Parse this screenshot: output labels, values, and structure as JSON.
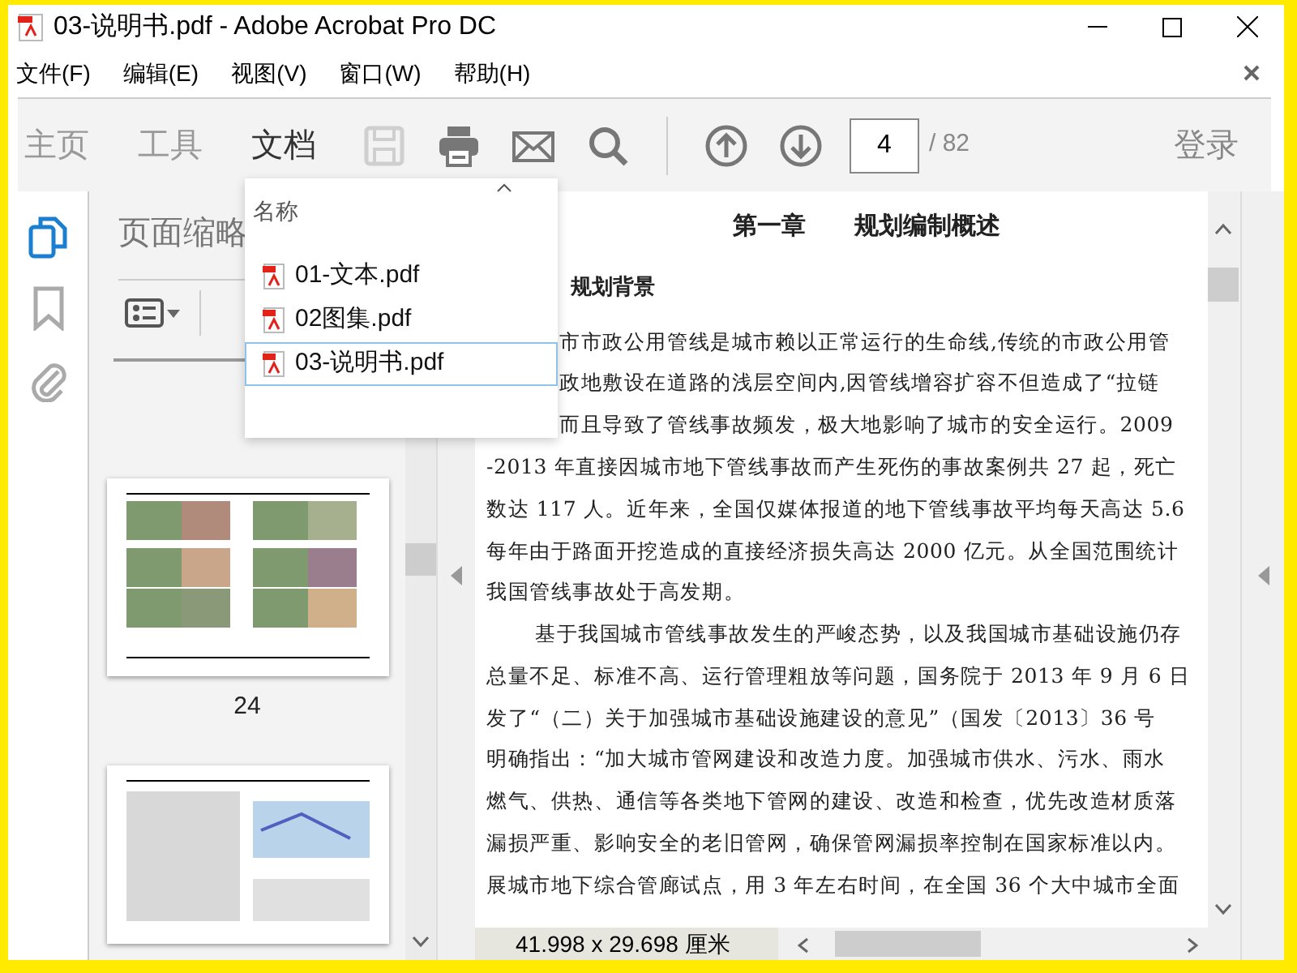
{
  "window": {
    "title": "03-说明书.pdf - Adobe Acrobat Pro DC"
  },
  "menu": [
    "文件(F)",
    "编辑(E)",
    "视图(V)",
    "窗口(W)",
    "帮助(H)"
  ],
  "toolbar": {
    "tabs": [
      {
        "label": "主页",
        "selected": false
      },
      {
        "label": "工具",
        "selected": false
      },
      {
        "label": "文档",
        "selected": true
      }
    ],
    "tools": [
      {
        "kind": "save",
        "disabled": true
      },
      {
        "kind": "print",
        "disabled": false
      },
      {
        "kind": "mail",
        "disabled": false
      },
      {
        "kind": "search",
        "disabled": false
      },
      {
        "kind": "divider"
      },
      {
        "kind": "up",
        "disabled": false
      },
      {
        "kind": "down",
        "disabled": false
      }
    ],
    "page": "4",
    "page_total": "/ 82",
    "sign_in": "登录"
  },
  "side_rail": [
    {
      "kind": "pages",
      "selected": true
    },
    {
      "kind": "bookmarks",
      "selected": false
    },
    {
      "kind": "attachments",
      "selected": false
    }
  ],
  "thumbnail_panel": {
    "title": "页面缩略",
    "thumbnails": [
      {
        "kind": "maps",
        "label": "24"
      },
      {
        "kind": "text_map"
      }
    ]
  },
  "file_dropdown": {
    "header": "名称",
    "files": [
      {
        "name": "01-文本.pdf",
        "selected": false
      },
      {
        "name": "02图集.pdf",
        "selected": false
      },
      {
        "name": "03-说明书.pdf",
        "selected": true
      }
    ]
  },
  "document": {
    "heading": "第一章　　规划编制概述",
    "subheading": "规划背景",
    "lines": [
      {
        "kind": "covered",
        "text": "市市政公用管线是城市赖以正常运行的生命线,传统的市政公用管"
      },
      {
        "kind": "covered",
        "text": "政地敷设在道路的浅层空间内,因管线增容扩容不但造成了“拉链"
      },
      {
        "kind": "covered",
        "text": "而且导致了管线事故频发，极大地影响了城市的安全运行。2009"
      },
      {
        "kind": "line",
        "text": "-2013 年直接因城市地下管线事故而产生死伤的事故案例共 27 起，死亡"
      },
      {
        "kind": "line",
        "text": "数达 117 人。近年来，全国仅媒体报道的地下管线事故平均每天高达 5.6"
      },
      {
        "kind": "line",
        "text": "每年由于路面开挖造成的直接经济损失高达 2000 亿元。从全国范围统计"
      },
      {
        "kind": "line",
        "text": "我国管线事故处于高发期。"
      },
      {
        "kind": "indent",
        "text": "基于我国城市管线事故发生的严峻态势，以及我国城市基础设施仍存"
      },
      {
        "kind": "line",
        "text": "总量不足、标准不高、运行管理粗放等问题，国务院于 2013 年 9 月 6 日"
      },
      {
        "kind": "line",
        "text": "发了“（二）关于加强城市基础设施建设的意见”（国发〔2013〕36 号"
      },
      {
        "kind": "line",
        "text": "明确指出：“加大城市管网建设和改造力度。加强城市供水、污水、雨水"
      },
      {
        "kind": "line",
        "text": "燃气、供热、通信等各类地下管网的建设、改造和检查，优先改造材质落"
      },
      {
        "kind": "line",
        "text": "漏损严重、影响安全的老旧管网，确保管网漏损率控制在国家标准以内。"
      },
      {
        "kind": "line",
        "text": "展城市地下综合管廊试点，用 3 年左右时间，在全国 36 个大中城市全面"
      }
    ]
  },
  "status_bar": "41.998 x 29.698 厘米"
}
